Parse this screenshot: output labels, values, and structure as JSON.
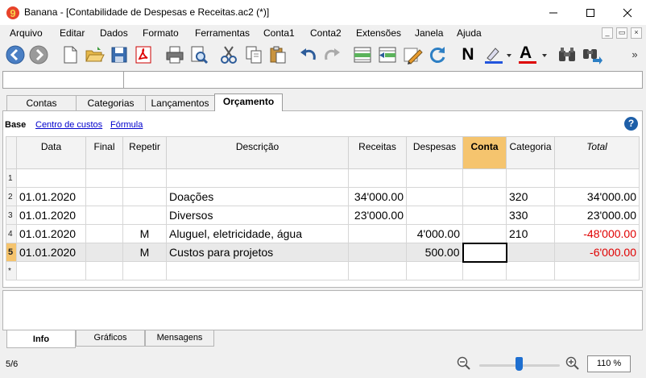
{
  "window": {
    "title": "Banana - [Contabilidade de Despesas e Receitas.ac2 (*)]",
    "app_icon": "banana-9-icon",
    "controls": [
      "minimize-icon",
      "maximize-icon",
      "close-icon"
    ]
  },
  "menu": {
    "items": [
      "Arquivo",
      "Editar",
      "Dados",
      "Formato",
      "Ferramentas",
      "Conta1",
      "Conta2",
      "Extensões",
      "Janela",
      "Ajuda"
    ],
    "mdi_controls": [
      "_",
      "▭",
      "×"
    ]
  },
  "toolbar": {
    "icons": [
      "back-icon",
      "forward-icon",
      "new-file-icon",
      "open-folder-icon",
      "save-icon",
      "pdf-icon",
      "print-icon",
      "print-preview-icon",
      "cut-icon",
      "copy-icon",
      "paste-icon",
      "undo-icon",
      "redo-icon",
      "add-row-icon",
      "delete-row-icon",
      "edit-pencil-icon",
      "recalculate-icon",
      "bold-icon",
      "highlight-color-icon",
      "text-color-icon",
      "find-icon",
      "find-next-icon",
      "more-icon"
    ],
    "bold_label": "N",
    "text_color_label": "A",
    "more_label": "»",
    "accent_highlight": "#2255dd",
    "accent_text": "#dd0000"
  },
  "formula": {
    "cell_ref": "",
    "content": ""
  },
  "tabs": [
    "Contas",
    "Categorias",
    "Lançamentos",
    "Orçamento"
  ],
  "active_tab": "Orçamento",
  "views": {
    "base": "Base",
    "links": [
      "Centro de custos",
      "Fórmula"
    ]
  },
  "help_label": "?",
  "table": {
    "columns": [
      "Data",
      "Final",
      "Repetir",
      "Descrição",
      "Receitas",
      "Despesas",
      "Conta",
      "Categoria",
      "Total"
    ],
    "rows": [
      {
        "rn": "1",
        "data": "",
        "final": "",
        "repetir": "",
        "descricao": "",
        "receitas": "",
        "despesas": "",
        "conta": "",
        "categoria": "",
        "total": ""
      },
      {
        "rn": "2",
        "data": "01.01.2020",
        "final": "",
        "repetir": "",
        "descricao": "Doações",
        "receitas": "34'000.00",
        "despesas": "",
        "conta": "",
        "categoria": "320",
        "total": "34'000.00"
      },
      {
        "rn": "3",
        "data": "01.01.2020",
        "final": "",
        "repetir": "",
        "descricao": "Diversos",
        "receitas": "23'000.00",
        "despesas": "",
        "conta": "",
        "categoria": "330",
        "total": "23'000.00"
      },
      {
        "rn": "4",
        "data": "01.01.2020",
        "final": "",
        "repetir": "M",
        "descricao": "Aluguel, eletricidade, água",
        "receitas": "",
        "despesas": "4'000.00",
        "conta": "",
        "categoria": "210",
        "total": "-48'000.00"
      },
      {
        "rn": "5",
        "data": "01.01.2020",
        "final": "",
        "repetir": "M",
        "descricao": "Custos para projetos",
        "receitas": "",
        "despesas": "500.00",
        "conta": "",
        "categoria": "",
        "total": "-6'000.00"
      },
      {
        "rn": "*",
        "data": "",
        "final": "",
        "repetir": "",
        "descricao": "",
        "receitas": "",
        "despesas": "",
        "conta": "",
        "categoria": "",
        "total": ""
      }
    ],
    "current_row": 5,
    "negative_color": "#e00000",
    "header_highlight_color": "#f5c46e"
  },
  "bottom_tabs": [
    "Info",
    "Gráficos",
    "Mensagens"
  ],
  "active_bottom_tab": "Info",
  "status": {
    "position": "5/6",
    "zoom": "110 %",
    "zoom_out_icon": "zoom-out-icon",
    "zoom_in_icon": "zoom-in-icon"
  }
}
